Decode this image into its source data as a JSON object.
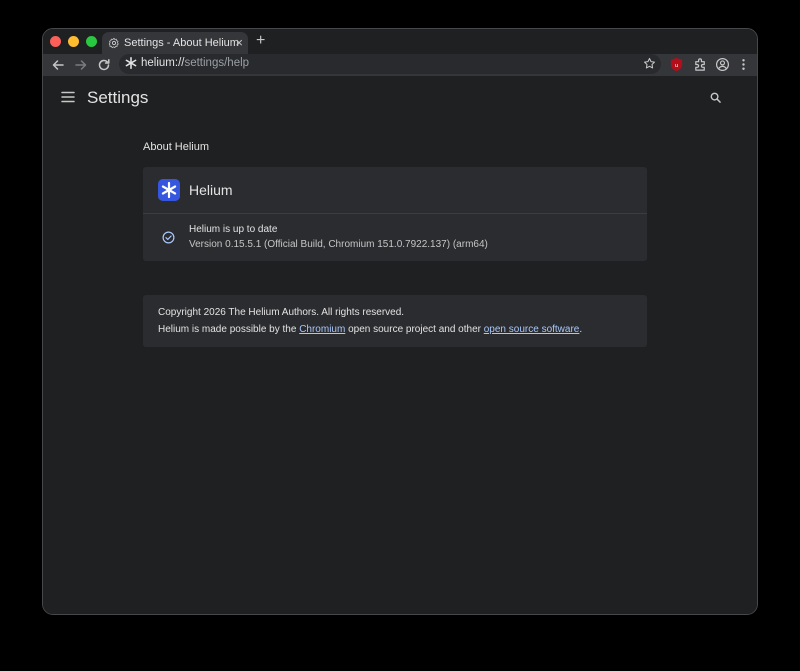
{
  "tab": {
    "title": "Settings - About Helium",
    "close_glyph": "×",
    "new_tab_glyph": "+"
  },
  "omnibox": {
    "host": "helium://",
    "path": "settings/help"
  },
  "header": {
    "title": "Settings"
  },
  "about": {
    "section_title": "About Helium",
    "app_name": "Helium",
    "status": "Helium is up to date",
    "version": "Version 0.15.5.1 (Official Build, Chromium 151.0.7922.137) (arm64)"
  },
  "legal": {
    "copyright": "Copyright 2026 The Helium Authors. All rights reserved.",
    "credits_prefix": "Helium is made possible by the ",
    "chromium_link": "Chromium",
    "credits_middle": " open source project and other ",
    "oss_link": "open source software",
    "credits_suffix": "."
  },
  "colors": {
    "accent_logo": "#3656e0",
    "link": "#a8c7fa",
    "ublock_red": "#b30f1b"
  },
  "icons": {
    "tab": "gear-icon",
    "site": "asterisk-icon",
    "back": "arrow-left-icon",
    "forward": "arrow-right-icon",
    "reload": "reload-icon",
    "bookmark": "star-icon",
    "ublock": "ublock-shield-icon",
    "extensions": "puzzle-icon",
    "profile": "profile-icon",
    "more": "kebab-menu-icon",
    "menu": "hamburger-icon",
    "search": "search-icon",
    "status": "check-circle-icon"
  }
}
